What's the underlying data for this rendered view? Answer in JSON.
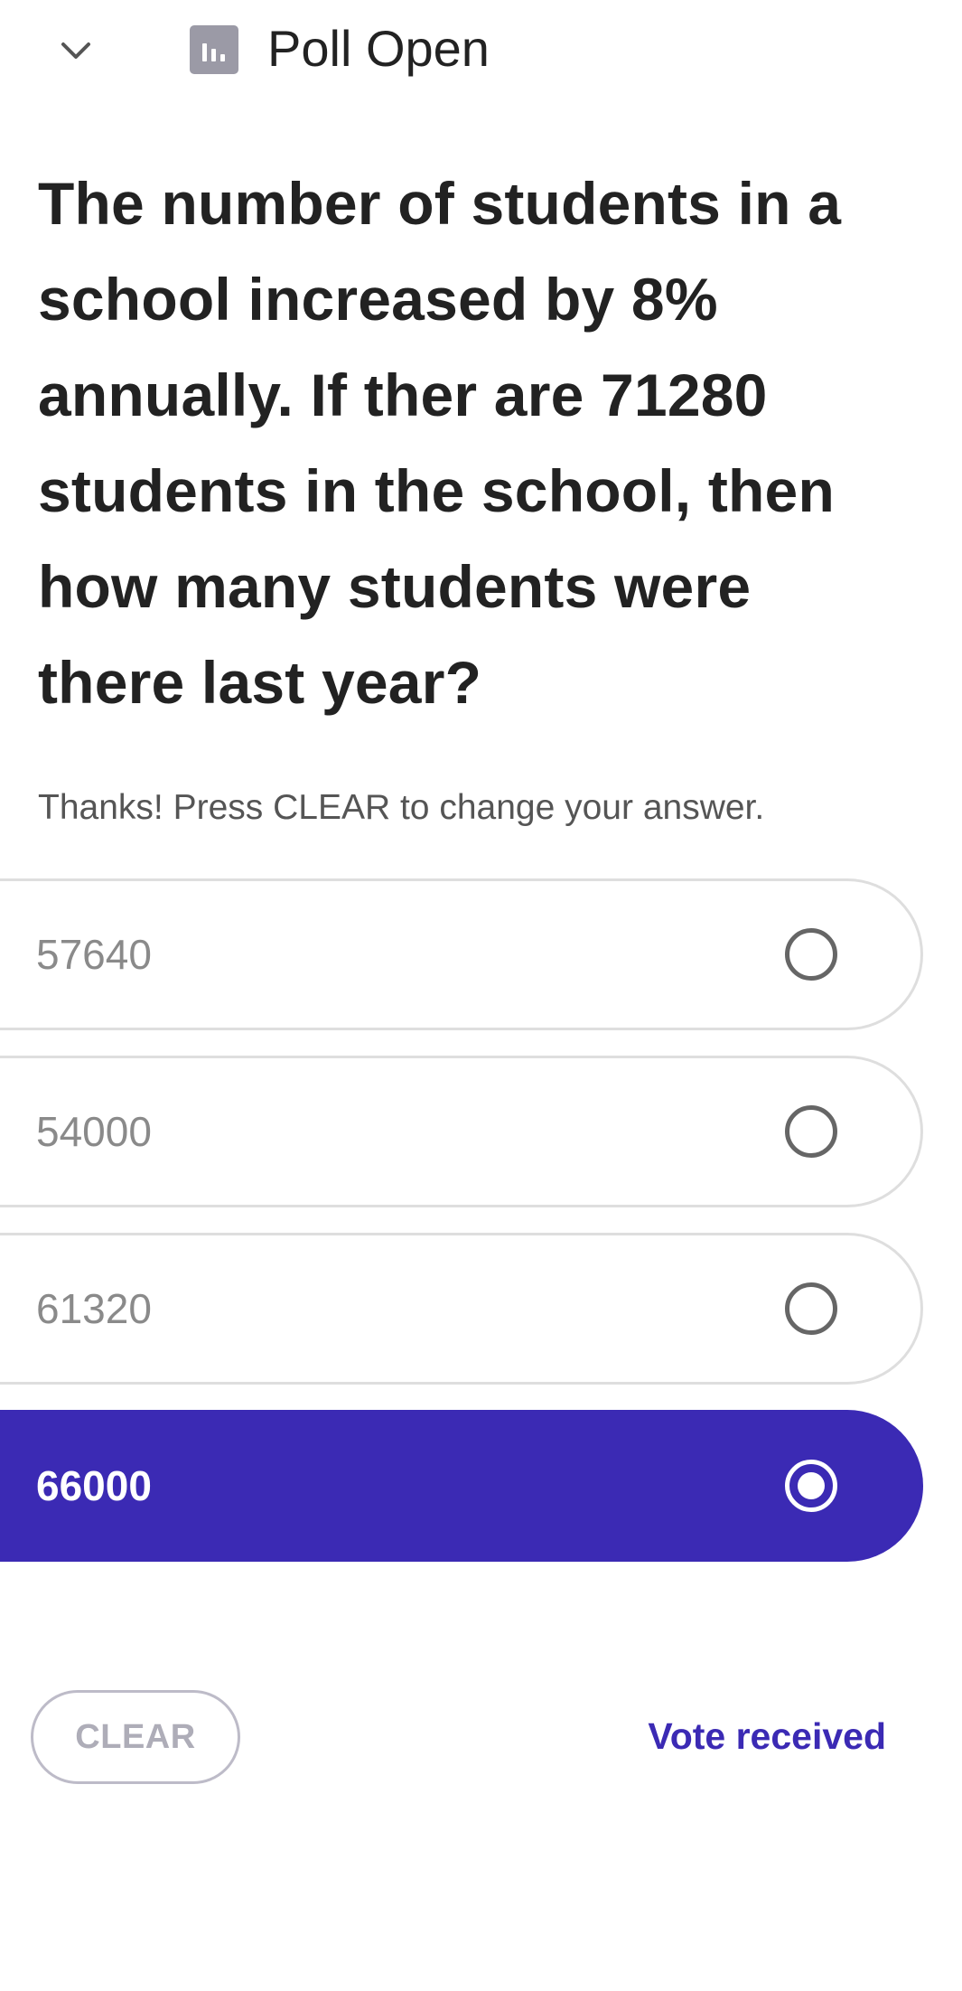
{
  "header": {
    "chevron_icon": "chevron-down-icon",
    "poll_icon": "bar-chart-icon",
    "title": "Poll Open"
  },
  "question": {
    "text": "The number of students in a school increased by 8% annually. If ther are 71280 students in the school, then how many students were there last year?"
  },
  "helper_text": "Thanks! Press CLEAR to change your answer.",
  "options": [
    {
      "label": "57640",
      "selected": false
    },
    {
      "label": "54000",
      "selected": false
    },
    {
      "label": "61320",
      "selected": false
    },
    {
      "label": "66000",
      "selected": true
    }
  ],
  "footer": {
    "clear_label": "CLEAR",
    "status_text": "Vote received"
  },
  "colors": {
    "accent": "#3b2ab4",
    "option_border": "#dedede",
    "clear_border": "#bdbbc8"
  }
}
